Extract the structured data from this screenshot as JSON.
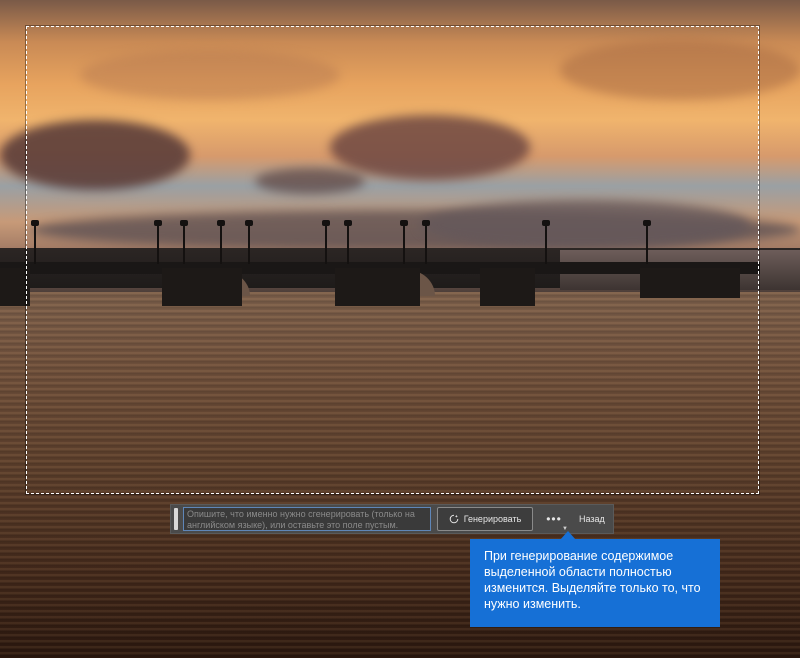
{
  "toolbar": {
    "prompt_placeholder": "Опишите, что именно нужно сгенерировать (только на английском языке), или оставьте это поле пустым.",
    "generate_label": "Генерировать",
    "more_label": "•••",
    "back_label": "Назад"
  },
  "tooltip": {
    "text": "При генерирование содержимое выделенной области полностью изменится. Выделяйте только то, что нужно изменить."
  },
  "colors": {
    "tooltip_bg": "#1670d6",
    "toolbar_bg": "#4a4a4a",
    "input_border": "#5f86b8"
  },
  "icons": {
    "generate": "generate-sparkle-icon",
    "more": "more-dots-icon"
  }
}
